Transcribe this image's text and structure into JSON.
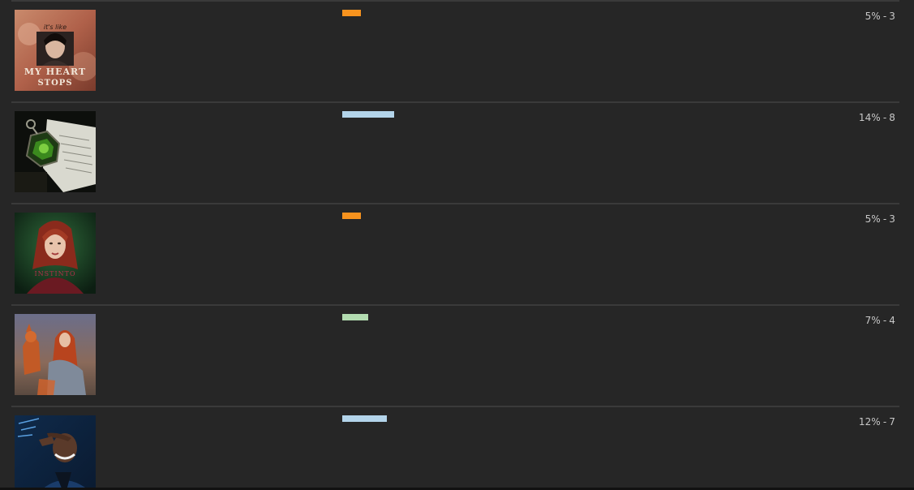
{
  "options": [
    {
      "thumb_name": "option-thumbnail-my-heart-stops",
      "thumb_text_top": "it's like",
      "thumb_text_line1": "MY HEART",
      "thumb_text_line2": "STOPS",
      "percent_label": "5%",
      "count_label": "3",
      "percent": 5,
      "bar_color": "#f7931e"
    },
    {
      "thumb_name": "option-thumbnail-locket",
      "percent_label": "14%",
      "count_label": "8",
      "percent": 14,
      "bar_color": "#b3d4ea"
    },
    {
      "thumb_name": "option-thumbnail-red-haired-woman",
      "thumb_text_line1": "INSTINTO",
      "percent_label": "5%",
      "count_label": "3",
      "percent": 5,
      "bar_color": "#f7931e"
    },
    {
      "thumb_name": "option-thumbnail-woman-with-fox",
      "percent_label": "7%",
      "count_label": "4",
      "percent": 7,
      "bar_color": "#b2dbb0"
    },
    {
      "thumb_name": "option-thumbnail-smiling-man",
      "percent_label": "12%",
      "count_label": "7",
      "percent": 12,
      "bar_color": "#b3d4ea"
    }
  ],
  "separator": "-"
}
